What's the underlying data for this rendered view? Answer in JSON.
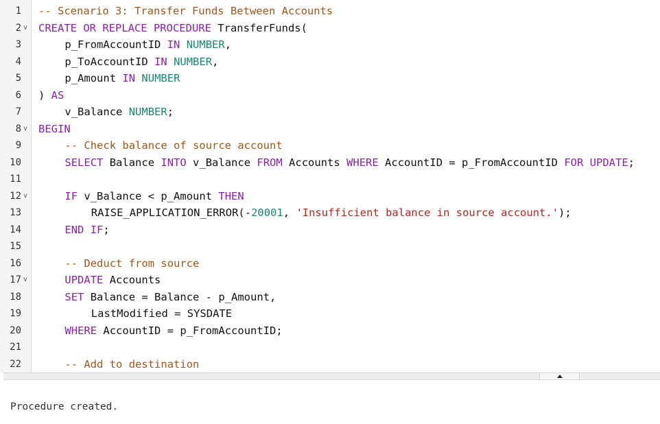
{
  "editor": {
    "lines": [
      {
        "number": "1",
        "fold": false,
        "indent": 0,
        "tokens": [
          {
            "t": "cm",
            "v": "-- Scenario 3: Transfer Funds Between Accounts"
          }
        ]
      },
      {
        "number": "2",
        "fold": true,
        "indent": 0,
        "tokens": [
          {
            "t": "kw",
            "v": "CREATE OR REPLACE PROCEDURE"
          },
          {
            "t": "tx",
            "v": " TransferFunds("
          }
        ]
      },
      {
        "number": "3",
        "fold": false,
        "indent": 4,
        "tokens": [
          {
            "t": "tx",
            "v": "p_FromAccountID "
          },
          {
            "t": "kw",
            "v": "IN"
          },
          {
            "t": "tx",
            "v": " "
          },
          {
            "t": "ty",
            "v": "NUMBER"
          },
          {
            "t": "tx",
            "v": ","
          }
        ]
      },
      {
        "number": "4",
        "fold": false,
        "indent": 4,
        "tokens": [
          {
            "t": "tx",
            "v": "p_ToAccountID "
          },
          {
            "t": "kw",
            "v": "IN"
          },
          {
            "t": "tx",
            "v": " "
          },
          {
            "t": "ty",
            "v": "NUMBER"
          },
          {
            "t": "tx",
            "v": ","
          }
        ]
      },
      {
        "number": "5",
        "fold": false,
        "indent": 4,
        "tokens": [
          {
            "t": "tx",
            "v": "p_Amount "
          },
          {
            "t": "kw",
            "v": "IN"
          },
          {
            "t": "tx",
            "v": " "
          },
          {
            "t": "ty",
            "v": "NUMBER"
          }
        ]
      },
      {
        "number": "6",
        "fold": false,
        "indent": 0,
        "tokens": [
          {
            "t": "tx",
            "v": ") "
          },
          {
            "t": "kw",
            "v": "AS"
          }
        ]
      },
      {
        "number": "7",
        "fold": false,
        "indent": 4,
        "tokens": [
          {
            "t": "tx",
            "v": "v_Balance "
          },
          {
            "t": "ty",
            "v": "NUMBER"
          },
          {
            "t": "tx",
            "v": ";"
          }
        ]
      },
      {
        "number": "8",
        "fold": true,
        "indent": 0,
        "tokens": [
          {
            "t": "kw",
            "v": "BEGIN"
          }
        ]
      },
      {
        "number": "9",
        "fold": false,
        "indent": 4,
        "tokens": [
          {
            "t": "cm",
            "v": "-- Check balance of source account"
          }
        ]
      },
      {
        "number": "10",
        "fold": false,
        "indent": 4,
        "tokens": [
          {
            "t": "kw",
            "v": "SELECT"
          },
          {
            "t": "tx",
            "v": " Balance "
          },
          {
            "t": "kw",
            "v": "INTO"
          },
          {
            "t": "tx",
            "v": " v_Balance "
          },
          {
            "t": "kw",
            "v": "FROM"
          },
          {
            "t": "tx",
            "v": " Accounts "
          },
          {
            "t": "kw",
            "v": "WHERE"
          },
          {
            "t": "tx",
            "v": " AccountID = p_FromAccountID "
          },
          {
            "t": "kw",
            "v": "FOR UPDATE"
          },
          {
            "t": "tx",
            "v": ";"
          }
        ]
      },
      {
        "number": "11",
        "fold": false,
        "indent": 0,
        "tokens": []
      },
      {
        "number": "12",
        "fold": true,
        "indent": 4,
        "tokens": [
          {
            "t": "kw",
            "v": "IF"
          },
          {
            "t": "tx",
            "v": " v_Balance < p_Amount "
          },
          {
            "t": "kw",
            "v": "THEN"
          }
        ]
      },
      {
        "number": "13",
        "fold": false,
        "indent": 8,
        "tokens": [
          {
            "t": "tx",
            "v": "RAISE_APPLICATION_ERROR(-"
          },
          {
            "t": "nu",
            "v": "20001"
          },
          {
            "t": "tx",
            "v": ", "
          },
          {
            "t": "st",
            "v": "'Insufficient balance in source account.'"
          },
          {
            "t": "tx",
            "v": ");"
          }
        ]
      },
      {
        "number": "14",
        "fold": false,
        "indent": 4,
        "tokens": [
          {
            "t": "kw",
            "v": "END IF"
          },
          {
            "t": "tx",
            "v": ";"
          }
        ]
      },
      {
        "number": "15",
        "fold": false,
        "indent": 0,
        "tokens": []
      },
      {
        "number": "16",
        "fold": false,
        "indent": 4,
        "tokens": [
          {
            "t": "cm",
            "v": "-- Deduct from source"
          }
        ]
      },
      {
        "number": "17",
        "fold": true,
        "indent": 4,
        "tokens": [
          {
            "t": "kw",
            "v": "UPDATE"
          },
          {
            "t": "tx",
            "v": " Accounts"
          }
        ]
      },
      {
        "number": "18",
        "fold": false,
        "indent": 4,
        "tokens": [
          {
            "t": "kw",
            "v": "SET"
          },
          {
            "t": "tx",
            "v": " Balance = Balance - p_Amount,"
          }
        ]
      },
      {
        "number": "19",
        "fold": false,
        "indent": 8,
        "tokens": [
          {
            "t": "tx",
            "v": "LastModified = SYSDATE"
          }
        ]
      },
      {
        "number": "20",
        "fold": false,
        "indent": 4,
        "tokens": [
          {
            "t": "kw",
            "v": "WHERE"
          },
          {
            "t": "tx",
            "v": " AccountID = p_FromAccountID;"
          }
        ]
      },
      {
        "number": "21",
        "fold": false,
        "indent": 0,
        "tokens": []
      },
      {
        "number": "22",
        "fold": false,
        "indent": 4,
        "tokens": [
          {
            "t": "cm",
            "v": "-- Add to destination"
          }
        ]
      }
    ],
    "fold_icon": "chevron-down-icon"
  },
  "splitter": {
    "icon": "triangle-up-icon"
  },
  "output": {
    "message": "Procedure created."
  },
  "colors": {
    "keyword": "#8b20a8",
    "type": "#148a6a",
    "comment": "#a0561a",
    "string": "#b3261e",
    "gutter_bg": "#f5f5f5"
  }
}
